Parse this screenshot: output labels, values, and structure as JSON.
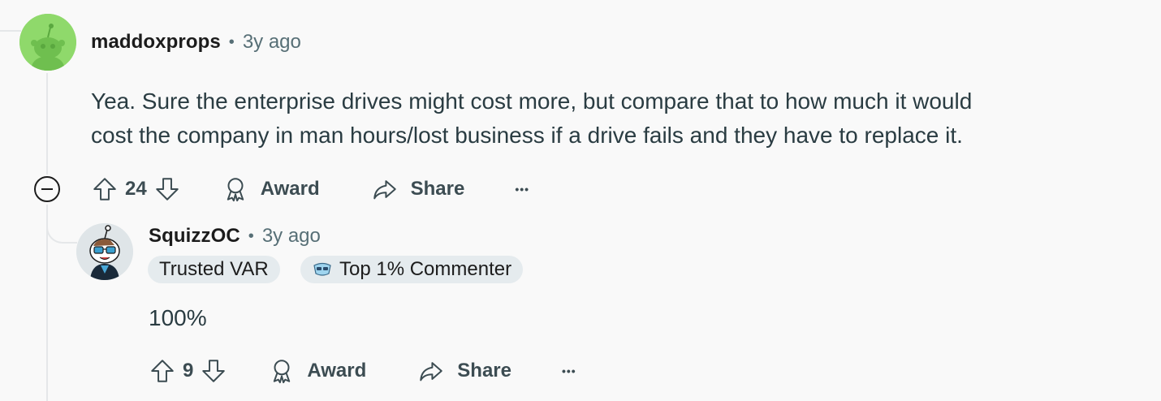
{
  "comments": [
    {
      "username": "maddoxprops",
      "separator": "•",
      "time": "3y ago",
      "body_line1": "Yea. Sure the enterprise drives might cost more, but compare that to how much it would",
      "body_line2": "cost the company in man hours/lost business if a drive fails and they have to replace it.",
      "votes": "24",
      "award_label": "Award",
      "share_label": "Share",
      "more_label": "•••",
      "avatar_color": "#8fd96b"
    },
    {
      "username": "SquizzOC",
      "separator": "•",
      "time": "3y ago",
      "flairs": [
        "Trusted VAR",
        "Top 1% Commenter"
      ],
      "body": "100%",
      "votes": "9",
      "award_label": "Award",
      "share_label": "Share",
      "more_label": "•••"
    }
  ],
  "icons": {
    "upvote": "upvote-icon",
    "downvote": "downvote-icon",
    "award": "award-icon",
    "share": "share-icon",
    "collapse": "collapse-icon",
    "badge": "commenter-badge-icon"
  }
}
